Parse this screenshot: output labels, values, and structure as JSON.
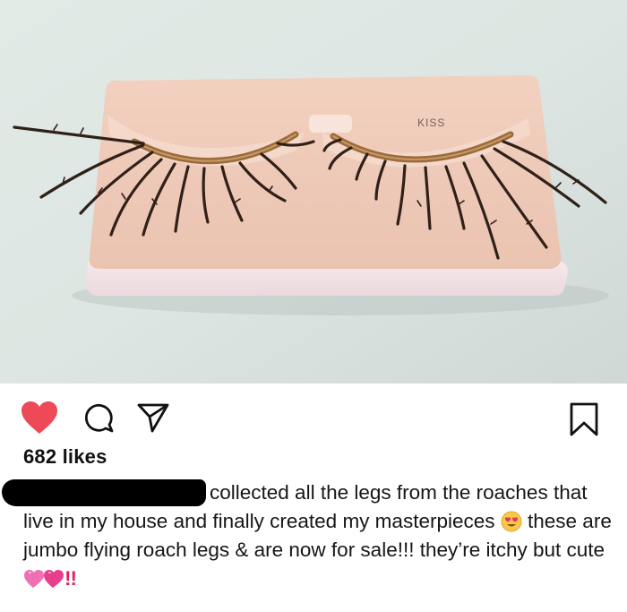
{
  "photo": {
    "description_icon": "false-eyelashes-image",
    "case_label": "KISS"
  },
  "actions": {
    "like_icon": "heart-icon",
    "comment_icon": "comment-icon",
    "share_icon": "share-icon",
    "save_icon": "bookmark-icon",
    "like_color": "#ed4956"
  },
  "post": {
    "likes": "682 likes",
    "caption_part1": "collected all the legs from the roaches that live in my house and finally created my masterpieces",
    "caption_part2": " these are jumbo flying roach legs & are now for sale!!! they’re itchy but cute",
    "caption_end": "!!"
  }
}
